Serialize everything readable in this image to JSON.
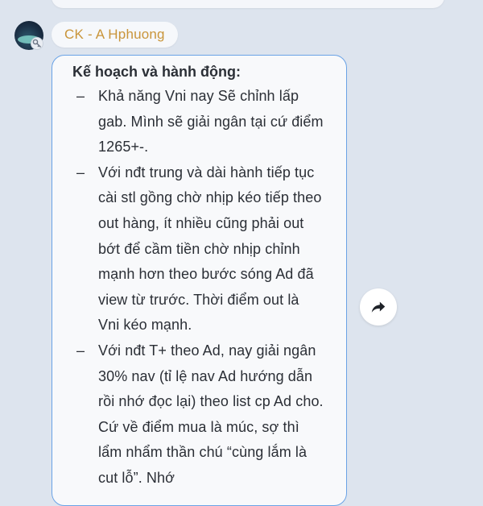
{
  "sender": {
    "name": "CK - A Hphuong"
  },
  "message": {
    "title": "Kế hoạch và hành động:",
    "bullet_marker": "–",
    "points": [
      "Khả năng Vni nay Sẽ chỉnh lấp gab. Mình sẽ giải ngân tại cứ điểm 1265+-.",
      "Với nđt trung và dài hành tiếp tục cài stl gồng chờ nhịp kéo tiếp theo out hàng, ít nhiều cũng phải out bớt để cầm tiền chờ nhịp chỉnh mạnh hơn theo bước sóng Ad đã view từ trước. Thời điểm out là Vni kéo mạnh.",
      "Với nđt T+ theo Ad, nay giải ngân 30% nav (tỉ lệ nav Ad hướng dẫn rồi nhớ đọc lại) theo list cp Ad cho. Cứ về điểm mua là múc, sợ thì lẩm nhẩm thần chú “cùng lắm là cut lỗ”. Nhớ"
    ]
  },
  "icons": {
    "share": "share-arrow-icon",
    "badge": "key-icon"
  },
  "colors": {
    "sender_name": "#c9953a",
    "bubble_border": "#6aa3e6",
    "background": "#dde4ee"
  }
}
